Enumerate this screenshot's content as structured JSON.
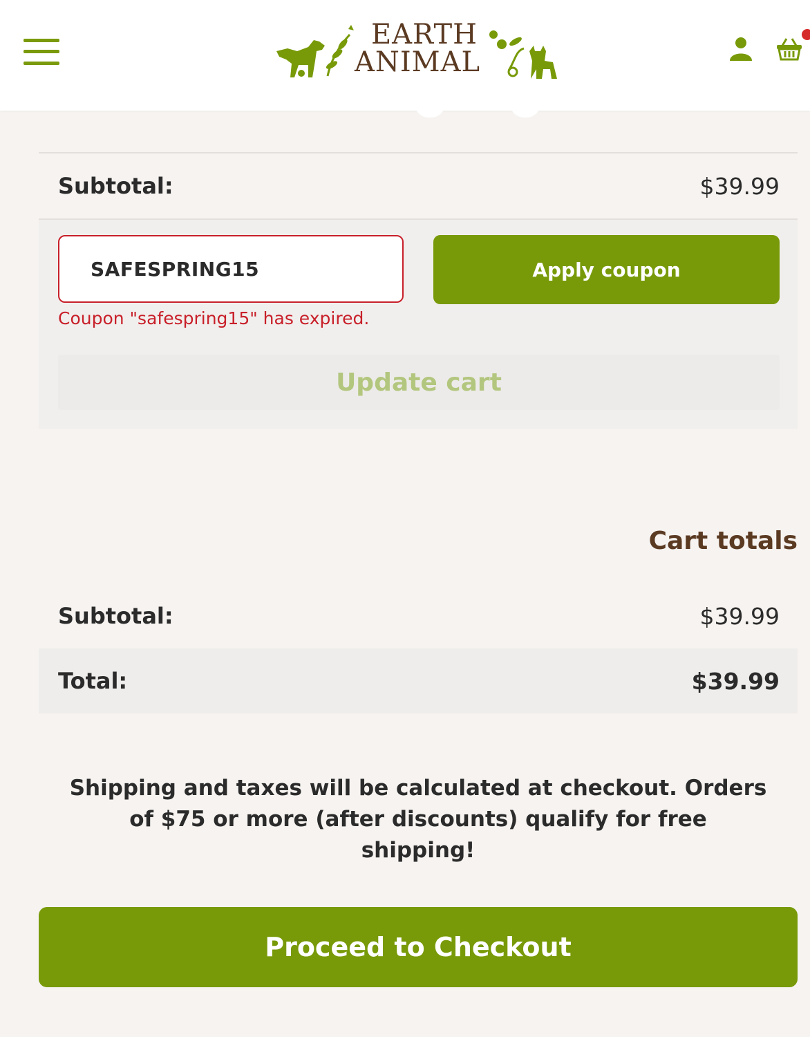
{
  "header": {
    "logo_line1": "EARTH",
    "logo_line2": "ANIMAL",
    "brand_color": "#789a08",
    "logo_color": "#5b3a22",
    "icons": [
      "menu-icon",
      "user-icon",
      "basket-icon"
    ]
  },
  "cart_summary": {
    "subtotal_label": "Subtotal:",
    "subtotal_value": "$39.99"
  },
  "coupon": {
    "input_value": "SAFESPRING15",
    "apply_label": "Apply coupon",
    "error_message": "Coupon \"safespring15\" has expired.",
    "error_color": "#c8202a"
  },
  "update_cart_label": "Update cart",
  "cart_totals": {
    "title": "Cart totals",
    "subtotal_label": "Subtotal:",
    "subtotal_value": "$39.99",
    "total_label": "Total:",
    "total_value": "$39.99"
  },
  "shipping_note": "Shipping and taxes will be calculated at checkout. Orders of $75 or more (after discounts) qualify for free shipping!",
  "checkout_label": "Proceed to Checkout"
}
